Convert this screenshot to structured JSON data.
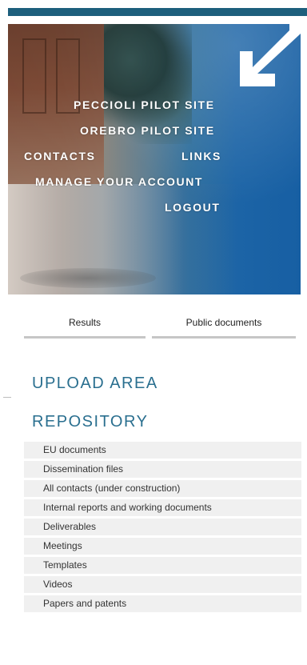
{
  "hero_menu": {
    "peccioli": "PECCIOLI PILOT SITE",
    "orebro": "OREBRO PILOT SITE",
    "contacts": "CONTACTS",
    "links": "LINKS",
    "manage_account": "MANAGE YOUR ACCOUNT",
    "logout": "LOGOUT"
  },
  "tabs": {
    "results": "Results",
    "public_documents": "Public documents"
  },
  "sections": {
    "upload_area": "UPLOAD AREA",
    "repository": "REPOSITORY"
  },
  "repository_items": [
    "EU documents",
    "Dissemination files",
    "All contacts (under construction)",
    "Internal reports and working documents",
    "Deliverables",
    "Meetings",
    "Templates",
    "Videos",
    "Papers and patents"
  ],
  "icons": {
    "hero_arrow": "arrow-down-left-icon"
  },
  "colors": {
    "top_bar": "#1d5f7c",
    "section_heading": "#2a6f8f",
    "list_bg": "#f0f0f0"
  }
}
